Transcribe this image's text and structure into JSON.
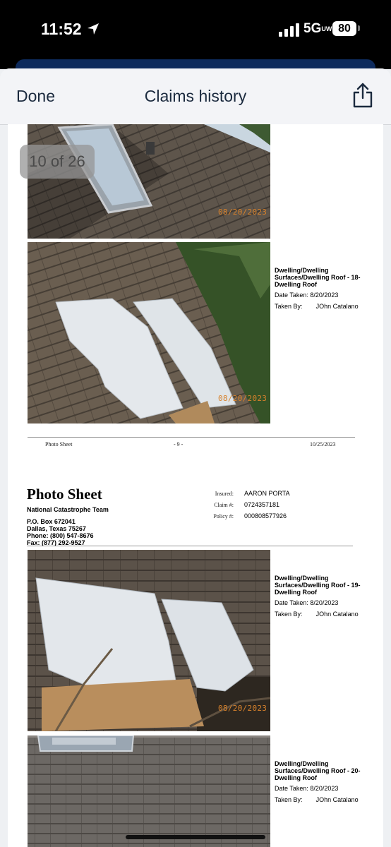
{
  "status_bar": {
    "time": "11:52",
    "network": "5G",
    "network_sub": "UW",
    "battery": "80"
  },
  "nav": {
    "done_label": "Done",
    "title": "Claims history"
  },
  "viewer": {
    "page_counter": "10 of 26"
  },
  "page1": {
    "photos": [
      {
        "date_stamp": "08/20/2023"
      },
      {
        "date_stamp": "08/20/2023"
      }
    ],
    "caption": {
      "label": "Dwelling/Dwelling Surfaces/Dwelling Roof - 18- Dwelling Roof",
      "date_taken": "Date Taken: 8/20/2023",
      "taken_by_label": "Taken By:",
      "taken_by": "JOhn Catalano"
    },
    "footer": {
      "left": "Photo Sheet",
      "center": "- 9 -",
      "right": "10/25/2023"
    }
  },
  "page2": {
    "header": {
      "title": "Photo Sheet",
      "team": "National Catastrophe Team",
      "address1": "P.O. Box 672041",
      "address2": "Dallas, Texas 75267",
      "phone": "Phone: (800) 547-8676",
      "fax": "Fax:  (877) 292-9527",
      "insured_label": "Insured:",
      "insured_value": "AARON PORTA",
      "claim_label": "Claim #:",
      "claim_value": "0724357181",
      "policy_label": "Policy #:",
      "policy_value": "000808577926"
    },
    "photos": [
      {
        "date_stamp": "08/20/2023"
      }
    ],
    "captions": [
      {
        "label": "Dwelling/Dwelling Surfaces/Dwelling Roof - 19- Dwelling Roof",
        "date_taken": "Date Taken: 8/20/2023",
        "taken_by_label": "Taken By:",
        "taken_by": "JOhn Catalano"
      },
      {
        "label": "Dwelling/Dwelling Surfaces/Dwelling Roof - 20- Dwelling Roof",
        "date_taken": "Date Taken: 8/20/2023",
        "taken_by_label": "Taken By:",
        "taken_by": "JOhn Catalano"
      }
    ]
  },
  "colors": {
    "status_bg": "#000000",
    "nav_text": "#1b2a3e",
    "date_stamp": "#d8822c"
  }
}
